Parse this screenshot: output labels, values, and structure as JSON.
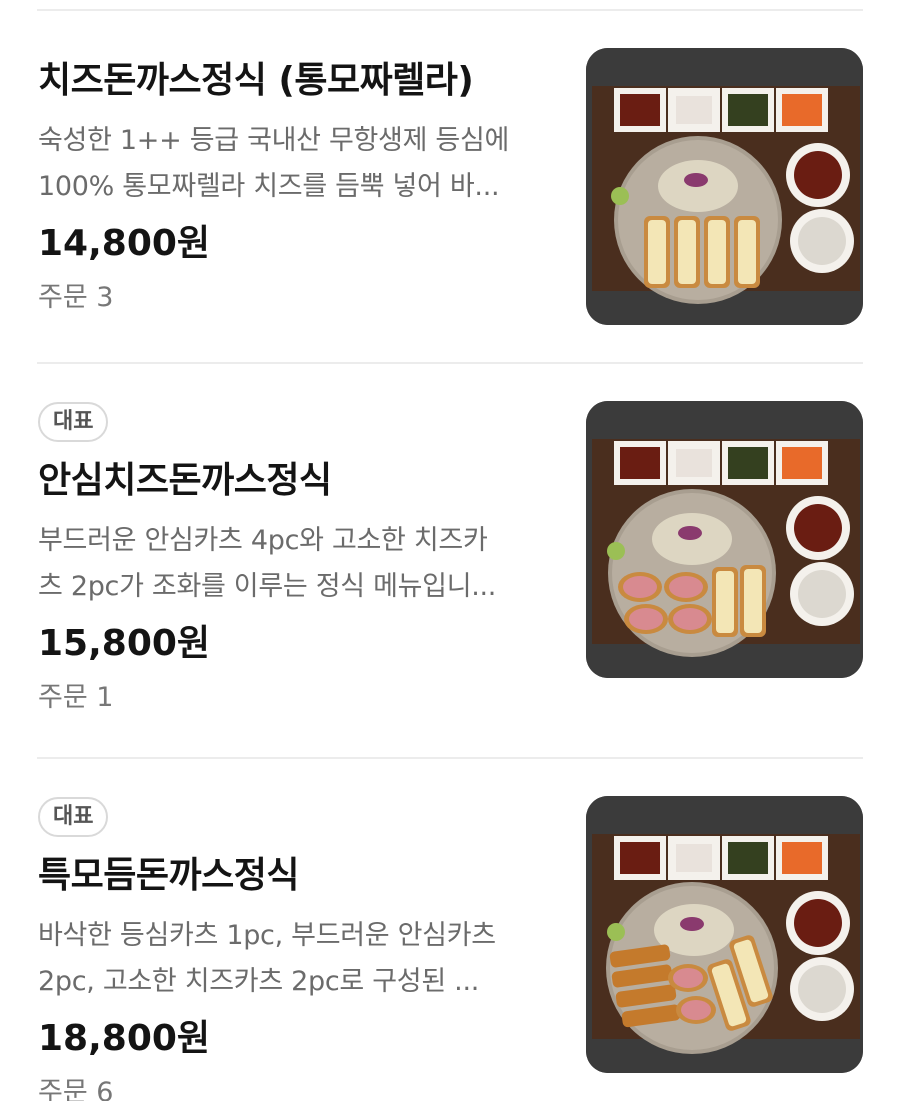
{
  "items": [
    {
      "badge": "",
      "title": "치즈돈까스정식 (통모짜렐라)",
      "desc_line1": "숙성한 1++ 등급 국내산 무항생제 등심에",
      "desc_line2": "100% 통모짜렐라 치즈를 듬뿍 넣어 바...",
      "price": "14,800원",
      "orders": "주문 3"
    },
    {
      "badge": "대표",
      "title": "안심치즈돈까스정식",
      "desc_line1": "부드러운 안심카츠 4pc와 고소한 치즈카",
      "desc_line2": "츠 2pc가 조화를 이루는 정식 메뉴입니...",
      "price": "15,800원",
      "orders": "주문 1"
    },
    {
      "badge": "대표",
      "title": "특모듬돈까스정식",
      "desc_line1": "바삭한 등심카츠 1pc, 부드러운 안심카츠",
      "desc_line2": "2pc, 고소한 치즈카츠 2pc로 구성된 ...",
      "price": "18,800원",
      "orders": "주문 6"
    }
  ],
  "colors": {
    "title": "#141414",
    "description": "#6b6b6b",
    "divider": "#ececec",
    "tray": "#4a2e1e",
    "plate": "#b8aea0"
  }
}
